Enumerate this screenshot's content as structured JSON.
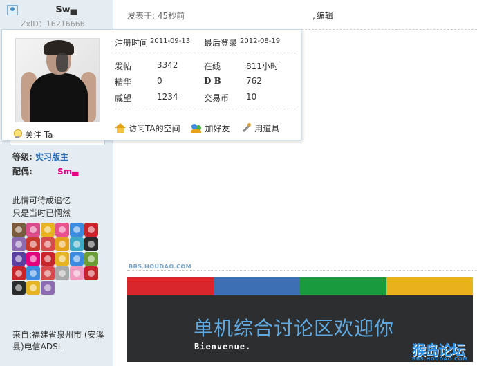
{
  "user": {
    "name": "Sw▄",
    "zxid": "ZxID：16216666",
    "level_label": "等级:",
    "level_value": "实习版主",
    "spouse_label": "配偶:",
    "spouse_value": "Sm▄",
    "signature_line1": "此情可待成追忆",
    "signature_line2": "只是当时已惘然",
    "location": "来自:福建省泉州市 (安溪县)电信ADSL"
  },
  "medal_colors": [
    "#7a5a3c",
    "#d84c8a",
    "#e6b422",
    "#e8538f",
    "#3d8be0",
    "#c8242b",
    "#8c6bb1",
    "#c83a2c",
    "#d64c4c",
    "#e6a11b",
    "#3fa9c8",
    "#2b2b2b",
    "#5b3f9e",
    "#e4007f",
    "#c8242b",
    "#e6b422",
    "#3d8be0",
    "#6a9e35",
    "#c8242b",
    "#3d8be0",
    "#d64c4c",
    "#aaa",
    "#f09ac0",
    "#c8242b",
    "#2b2b2b",
    "#e6b422",
    "#8c6bb1"
  ],
  "post": {
    "time": "发表于: 45秒前",
    "edit": "编辑"
  },
  "card": {
    "reg_label": "注册时间",
    "reg_value": "2011-09-13",
    "last_label": "最后登录",
    "last_value": "2012-08-19",
    "rows": [
      {
        "k": "发帖",
        "v": "3342",
        "k2": "在线",
        "v2": "811小时"
      },
      {
        "k": "精华",
        "v": "0",
        "k2": "D B",
        "v2": "762"
      },
      {
        "k": "威望",
        "v": "1234",
        "k2": "交易币",
        "v2": "10"
      }
    ],
    "follow": "关注 Ta",
    "actions": {
      "visit": "访问TA的空间",
      "add_friend": "加好友",
      "use_tool": "用道具"
    }
  },
  "banner": {
    "watermark": "BBS.HOUDAO.COM",
    "title": "单机综合讨论区欢迎你",
    "subtitle": "Bienvenue.",
    "stripe_colors": [
      "#d9262c",
      "#3d6fb5",
      "#1a9a3f",
      "#e9b21c"
    ],
    "site_logo": "猴岛论坛",
    "site_url": "BBS.HOUDAO.COM"
  }
}
